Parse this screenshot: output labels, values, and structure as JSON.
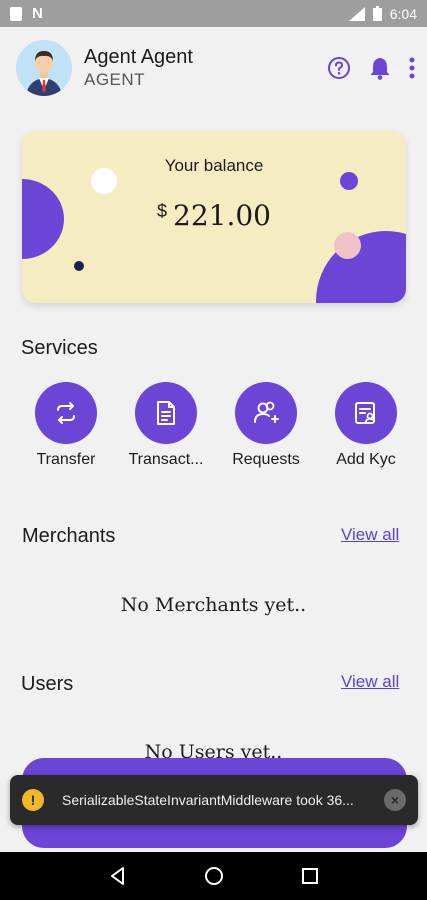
{
  "status_bar": {
    "time": "6:04",
    "n_label": "N"
  },
  "header": {
    "user_name": "Agent Agent",
    "user_role": "AGENT",
    "icons": [
      "help-icon",
      "bell-icon",
      "more-vert-icon"
    ]
  },
  "balance": {
    "label": "Your balance",
    "currency": "$",
    "amount": "221.00"
  },
  "services": {
    "title": "Services",
    "items": [
      {
        "label": "Transfer",
        "icon": "transfer-icon"
      },
      {
        "label": "Transact...",
        "icon": "document-icon"
      },
      {
        "label": "Requests",
        "icon": "add-user-icon"
      },
      {
        "label": "Add Kyc",
        "icon": "kyc-icon"
      }
    ]
  },
  "merchants": {
    "title": "Merchants",
    "view_all": "View all",
    "empty": "No Merchants yet.."
  },
  "users": {
    "title": "Users",
    "view_all": "View all",
    "empty": "No Users yet.."
  },
  "toast": {
    "message": "SerializableStateInvariantMiddleware took 36...",
    "icon": "warning-icon"
  },
  "colors": {
    "accent": "#6a45d6",
    "card_bg": "#f6ecc2",
    "page_bg": "#f1f1f1"
  }
}
